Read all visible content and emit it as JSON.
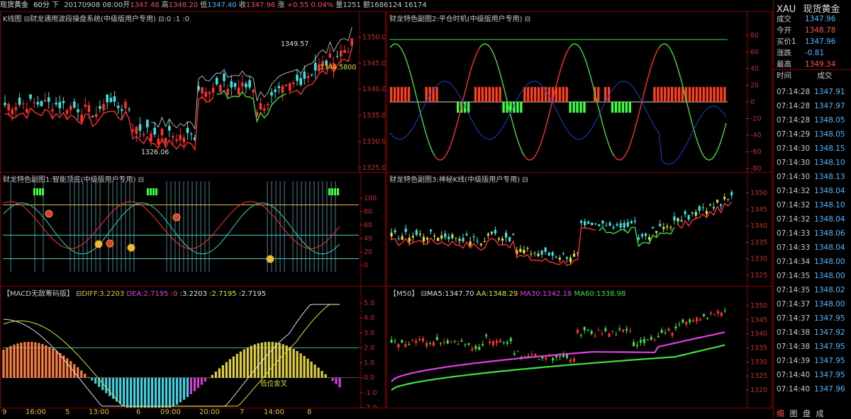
{
  "topbar": {
    "symbol": "现货黄金",
    "period": "60分",
    "down": "下",
    "datetime": "20170908 08:00",
    "open_label": "开",
    "open": "1347.48",
    "high_label": "高",
    "high": "1348.20",
    "low_label": "低",
    "low": "1347.40",
    "close_label": "收",
    "close": "1347.96",
    "change_label": "涨",
    "change": "+0.55",
    "change_pct": "0.04%",
    "vol_label": "量",
    "vol": "1251",
    "amount_label": "额",
    "amount": "1686124",
    "extra": "16174"
  },
  "panels": {
    "kline": {
      "title": "K线图 ⊟财龙通用波段操盘系统(中级版用户专用) ⊟:0 :1 :0",
      "axis": [
        "1350.0",
        "1345.0",
        "1340.0",
        "1335.0",
        "1330.0",
        "1325.0"
      ],
      "high_label": "1349.57",
      "low_label": "1326.06",
      "mark_label": "1344.5800"
    },
    "sub2": {
      "title": "财龙特色副图2:平仓时机(中级版用户专用) ⊟",
      "axis": [
        "80",
        "60",
        "40",
        "20",
        "0",
        "-20",
        "-40",
        "-60",
        "-80"
      ]
    },
    "sub1": {
      "title": "财龙特色副图1:智能顶底(中级版用户专用) ⊟",
      "axis": [
        "100",
        "80",
        "60",
        "40",
        "20",
        "0"
      ]
    },
    "sub3": {
      "title": "财龙特色副图3:神秘K线(中级版用户专用) ⊟",
      "axis": [
        "1350",
        "1345",
        "1340",
        "1335",
        "1330",
        "1325"
      ]
    },
    "macd": {
      "title": "【MACD无敌筹码版】 ⊟",
      "diff": "DIFF:3.2203",
      "dea": "DEA:2.7195",
      "z0": ":0",
      "v1": ":3.2203",
      "v2": ":2.7195",
      "v3": ":2.7195",
      "axis": [
        "5.0",
        "4.0",
        "3.0",
        "2.0",
        "1.0",
        "0.0",
        "-1.0",
        "-2.0"
      ],
      "annotation": "低位金叉"
    },
    "ma": {
      "title": "【M50】 ⊟",
      "ma5": "MA5:1347.70",
      "aa": "AA:1348.29",
      "ma30": "MA30:1342.18",
      "ma60": "MA60:1338.98",
      "axis": [
        "1350",
        "1345",
        "1340",
        "1335",
        "1330",
        "1325",
        "1320"
      ]
    }
  },
  "time_axis": [
    "9",
    "16:00",
    "5",
    "13:00",
    "6",
    "09:00",
    "20:00",
    "7",
    "14:00",
    "8"
  ],
  "right": {
    "code": "XAU",
    "name": "现货黄金",
    "quotes": [
      {
        "label": "成交",
        "value": "1347.96",
        "color": "#4fb8ff"
      },
      {
        "label": "今开",
        "value": "1348.78",
        "color": "#ff5050"
      },
      {
        "label": "买价1",
        "value": "1347.96",
        "color": "#4fb8ff"
      },
      {
        "label": "涨跌",
        "value": "-0.81",
        "color": "#4fb8ff"
      },
      {
        "label": "最高",
        "value": "1349.34",
        "color": "#ff5050"
      }
    ],
    "ticks_header": {
      "time": "时间",
      "price": "成交"
    },
    "ticks": [
      {
        "t": "07:14:28",
        "p": "1347.91"
      },
      {
        "t": "07:14:28",
        "p": "1347.97"
      },
      {
        "t": "07:14:28",
        "p": "1348.05"
      },
      {
        "t": "07:14:29",
        "p": "1348.05"
      },
      {
        "t": "07:14:30",
        "p": "1348.15"
      },
      {
        "t": "07:14:30",
        "p": "1348.10"
      },
      {
        "t": "07:14:30",
        "p": "1348.13"
      },
      {
        "t": "07:14:32",
        "p": "1348.04"
      },
      {
        "t": "07:14:32",
        "p": "1348.10"
      },
      {
        "t": "07:14:32",
        "p": "1348.04"
      },
      {
        "t": "07:14:33",
        "p": "1348.06"
      },
      {
        "t": "07:14:33",
        "p": "1348.04"
      },
      {
        "t": "07:14:34",
        "p": "1348.00"
      },
      {
        "t": "07:14:35",
        "p": "1348.00"
      },
      {
        "t": "07:14:35",
        "p": "1348.02"
      },
      {
        "t": "07:14:37",
        "p": "1348.00"
      },
      {
        "t": "07:14:37",
        "p": "1347.95"
      },
      {
        "t": "07:14:38",
        "p": "1347.92"
      },
      {
        "t": "07:14:38",
        "p": "1347.95"
      },
      {
        "t": "07:14:39",
        "p": "1347.95"
      },
      {
        "t": "07:14:40",
        "p": "1347.95"
      },
      {
        "t": "07:14:40",
        "p": "1347.96"
      }
    ],
    "tabs": [
      "细",
      "图",
      "盘",
      "成"
    ]
  },
  "colors": {
    "up": "#ff3030",
    "down": "#40e0e0",
    "frame": "#8b0000",
    "blue": "#4fb8ff",
    "yellow": "#e0c040"
  }
}
